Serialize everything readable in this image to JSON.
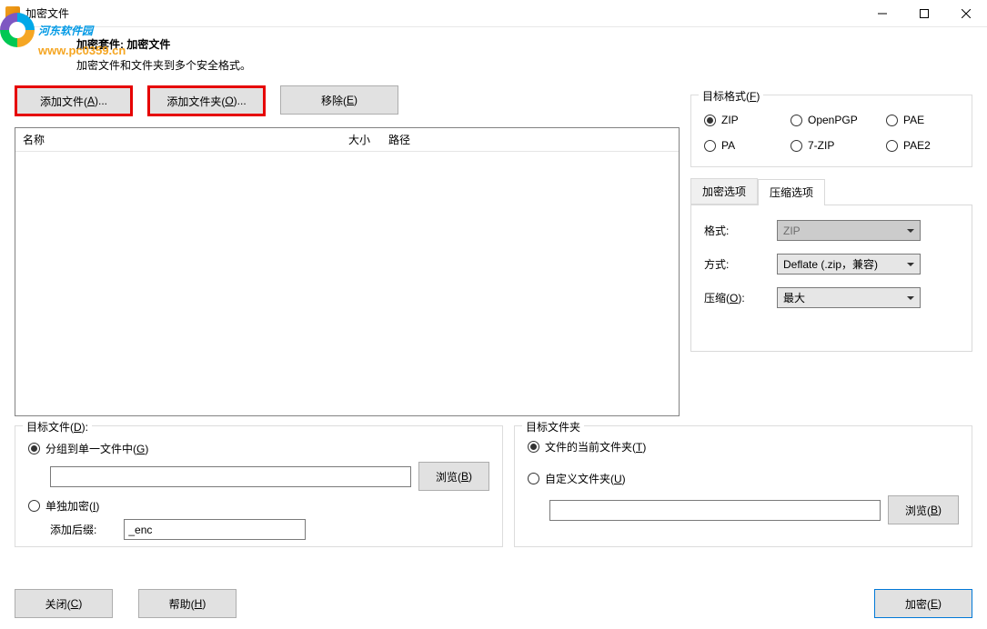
{
  "window": {
    "title": "加密文件"
  },
  "watermark": {
    "name": "河东软件园",
    "url": "www.pc0359.cn"
  },
  "header": {
    "suite_label": "加密套件:",
    "suite_value": "加密文件",
    "desc": "加密文件和文件夹到多个安全格式。"
  },
  "toolbar": {
    "add_file": "添加文件(A)...",
    "add_folder": "添加文件夹(O)...",
    "remove": "移除(E)"
  },
  "table": {
    "col_name": "名称",
    "col_size": "大小",
    "col_path": "路径"
  },
  "format_box": {
    "legend": "目标格式(F)",
    "items": [
      "ZIP",
      "OpenPGP",
      "PAE",
      "PA",
      "7-ZIP",
      "PAE2"
    ],
    "selected": "ZIP"
  },
  "tabs": {
    "encrypt": "加密选项",
    "compress": "压缩选项"
  },
  "compress": {
    "format_label": "格式:",
    "format_value": "ZIP",
    "method_label": "方式:",
    "method_value": "Deflate (.zip，兼容)",
    "level_label": "压缩(O):",
    "level_value": "最大"
  },
  "dest_file": {
    "legend": "目标文件(D):",
    "group_single": "分组到单一文件中(G)",
    "browse": "浏览(B)",
    "individual": "单独加密(I)",
    "suffix_label": "添加后缀:",
    "suffix_value": "_enc"
  },
  "dest_folder": {
    "legend": "目标文件夹",
    "current": "文件的当前文件夹(T)",
    "custom": "自定义文件夹(U)",
    "browse": "浏览(B)"
  },
  "footer": {
    "close": "关闭(C)",
    "help": "帮助(H)",
    "encrypt": "加密(E)"
  }
}
